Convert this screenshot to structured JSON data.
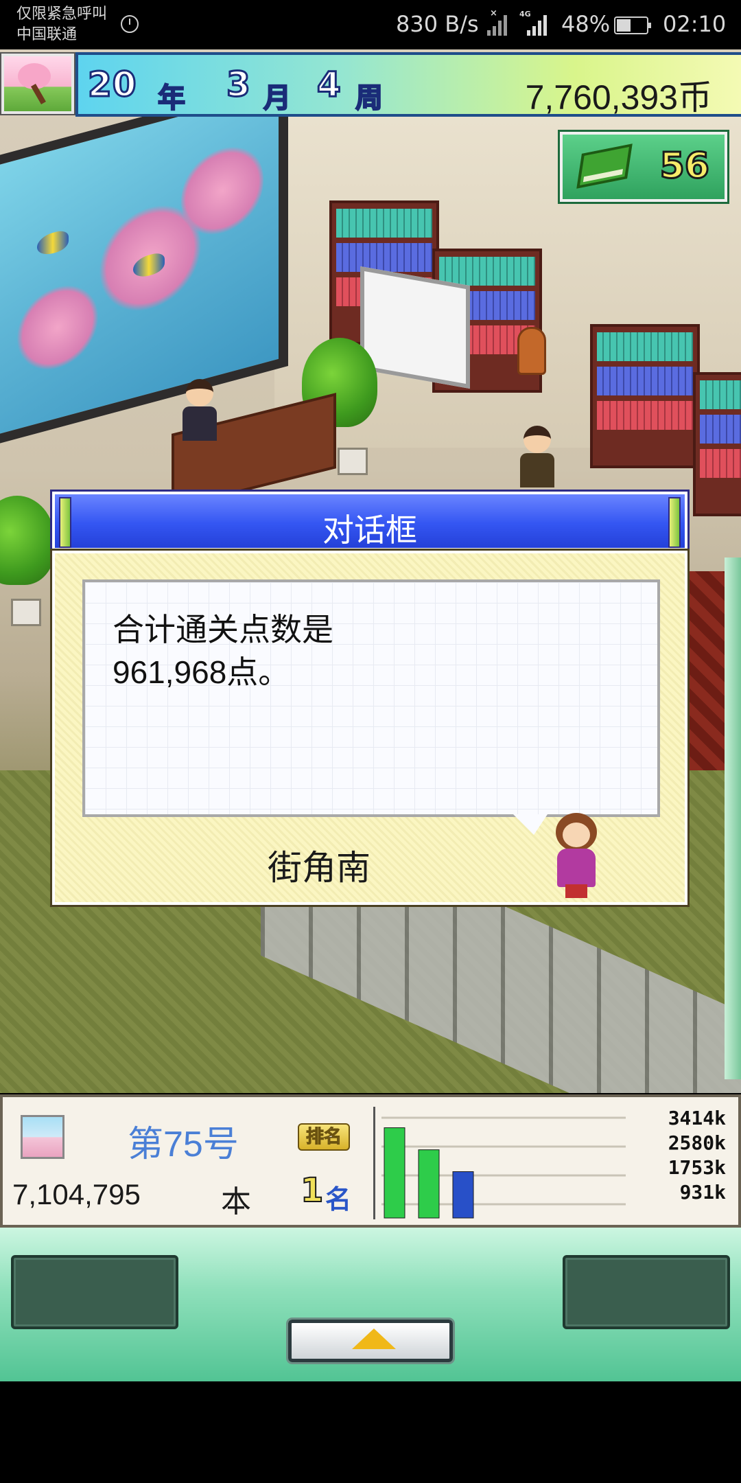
{
  "status_bar": {
    "carrier_line1": "仅限紧急呼叫",
    "carrier_line2": "中国联通",
    "network_speed": "830 B/s",
    "network_type": "4G",
    "battery": "48%",
    "time": "02:10"
  },
  "hud": {
    "year_value": "20",
    "year_unit": "年",
    "month_value": "3",
    "month_unit": "月",
    "week_value": "4",
    "week_unit": "周",
    "money": "7,760,393币",
    "book_count": "56",
    "icons": [
      "season-sakura-icon",
      "green-book-icon"
    ]
  },
  "dialog": {
    "title": "对话框",
    "message": "合计通关点数是\n961,968点。",
    "speaker": "街角南"
  },
  "info_panel": {
    "issue": "第75号",
    "sales_value": "7,104,795",
    "sales_unit": "本",
    "rank_label": "排名",
    "rank_value": "1",
    "rank_unit": "名"
  },
  "chart_data": {
    "type": "bar",
    "categories": [
      "",
      "",
      ""
    ],
    "values": [
      3414,
      2580,
      1753
    ],
    "colors": [
      "#2ecc4a",
      "#2ecc4a",
      "#2850c8"
    ],
    "tick_labels": [
      "3414k",
      "2580k",
      "1753k",
      "931k"
    ],
    "ylim": [
      0,
      4000
    ],
    "grid": true,
    "title": "",
    "xlabel": "",
    "ylabel": ""
  },
  "colors": {
    "dialog_title": "#3456f2",
    "dialog_body": "#fbf6c2",
    "nav_background": "#8fe0bb",
    "issue_text": "#4a7fd6"
  }
}
